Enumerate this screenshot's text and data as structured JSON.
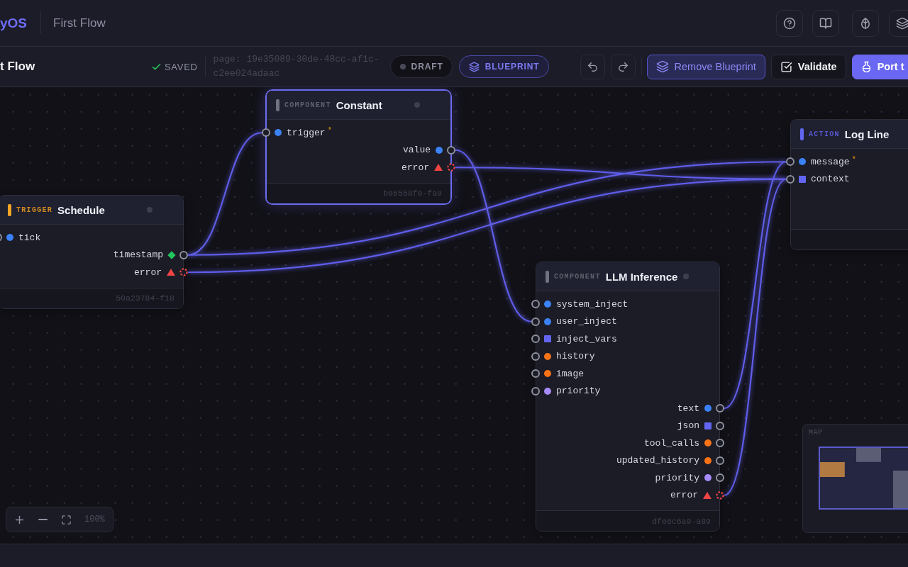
{
  "header": {
    "brand": "yOS",
    "flow_name": "First Flow"
  },
  "toolbar": {
    "title": "t Flow",
    "save_status": "SAVED",
    "page_ref": "page: 19e35089-30de-48cc-af1c-c2ee024adaac",
    "modes": [
      {
        "label": "DRAFT",
        "kind": "draft",
        "selected": false
      },
      {
        "label": "BLUEPRINT",
        "kind": "blueprint",
        "selected": true
      }
    ],
    "buttons": [
      {
        "label": "Remove Blueprint",
        "kind": "blueprint"
      },
      {
        "label": "Validate",
        "kind": "validate"
      },
      {
        "label": "Port t",
        "kind": "primary"
      }
    ]
  },
  "nodes": [
    {
      "category": "TRIGGER",
      "title": "Schedule",
      "color": "#f5a524",
      "selected": false,
      "inputs": [
        {
          "label": "tick",
          "kind": "dot",
          "color": "#3b82f6"
        }
      ],
      "outputs": [
        {
          "label": "timestamp",
          "kind": "diamond",
          "color": "#22c55e"
        },
        {
          "label": "error",
          "kind": "error",
          "color": "#ef4444"
        }
      ],
      "node_id": "50a23784-f18"
    },
    {
      "category": "COMPONENT",
      "title": "Constant",
      "color": "#70727f",
      "selected": true,
      "inputs": [
        {
          "label": "trigger",
          "kind": "dot",
          "color": "#3b82f6",
          "required_mark": "*"
        }
      ],
      "outputs": [
        {
          "label": "value",
          "kind": "dot",
          "color": "#3b82f6"
        },
        {
          "label": "error",
          "kind": "error",
          "color": "#ef4444"
        }
      ],
      "node_id": "b06558f9-fa9"
    },
    {
      "category": "COMPONENT",
      "title": "LLM Inference",
      "color": "#70727f",
      "selected": false,
      "inputs": [
        {
          "label": "system_inject",
          "kind": "dot",
          "color": "#3b82f6"
        },
        {
          "label": "user_inject",
          "kind": "dot",
          "color": "#3b82f6"
        },
        {
          "label": "inject_vars",
          "kind": "square",
          "color": "#6366f1"
        },
        {
          "label": "history",
          "kind": "dot",
          "color": "#f97316"
        },
        {
          "label": "image",
          "kind": "dot",
          "color": "#f97316"
        },
        {
          "label": "priority",
          "kind": "dot",
          "color": "#a78bfa"
        }
      ],
      "outputs": [
        {
          "label": "text",
          "kind": "dot",
          "color": "#3b82f6"
        },
        {
          "label": "json",
          "kind": "square",
          "color": "#6366f1"
        },
        {
          "label": "tool_calls",
          "kind": "dot",
          "color": "#f97316"
        },
        {
          "label": "updated_history",
          "kind": "dot",
          "color": "#f97316"
        },
        {
          "label": "priority",
          "kind": "dot",
          "color": "#a78bfa"
        },
        {
          "label": "error",
          "kind": "error",
          "color": "#ef4444"
        }
      ],
      "node_id": "dfe6c6a9-a89"
    },
    {
      "category": "ACTION",
      "title": "Log Line",
      "color": "#6366f1",
      "selected": false,
      "inputs": [
        {
          "label": "message",
          "kind": "dot",
          "color": "#3b82f6",
          "required_mark": "*"
        },
        {
          "label": "context",
          "kind": "square",
          "color": "#6366f1"
        }
      ]
    }
  ],
  "zoom_controls": {
    "zoom": "100%"
  },
  "minimap": {
    "label": "MAP"
  }
}
